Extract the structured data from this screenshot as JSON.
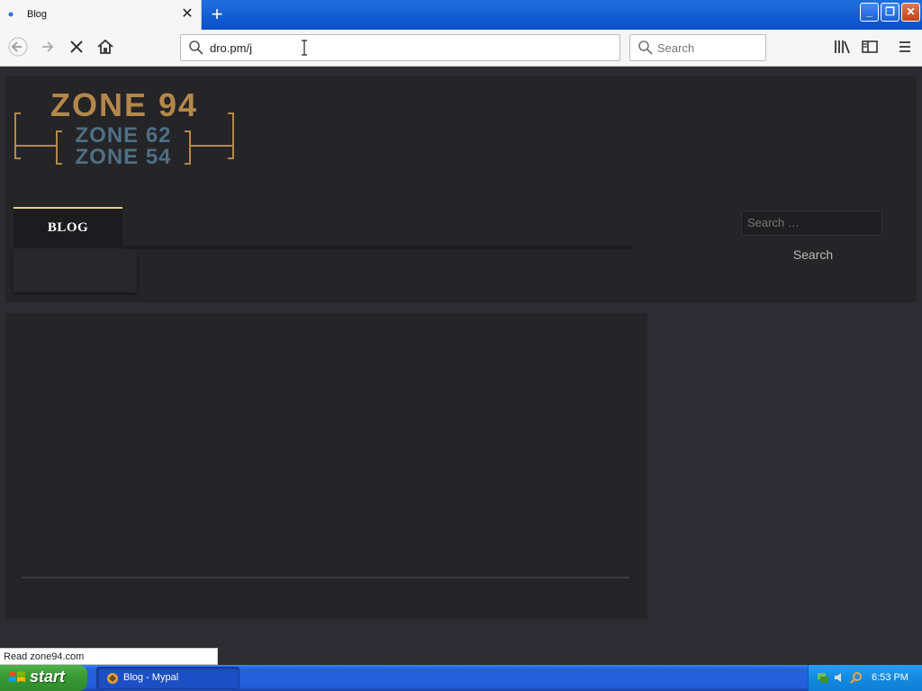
{
  "browser": {
    "tab_title": "Blog",
    "url": "dro.pm/j",
    "search_placeholder": "Search",
    "status_text": "Read zone94.com"
  },
  "site": {
    "logo": {
      "line1": "ZONE 94",
      "line2": "ZONE 62",
      "line3": "ZONE 54",
      "colors": {
        "primary": "#b4884a",
        "secondary": "#4f6f87"
      }
    },
    "nav_items": [
      {
        "label": "BLOG"
      }
    ],
    "search_placeholder": "Search …",
    "search_button": "Search"
  },
  "taskbar": {
    "start_label": "start",
    "task_label": "Blog - Mypal",
    "clock": "6:53 PM"
  },
  "colors": {
    "page_bg": "#2d2c32",
    "panel_bg": "#252427",
    "nav_accent": "#e7d26a"
  }
}
